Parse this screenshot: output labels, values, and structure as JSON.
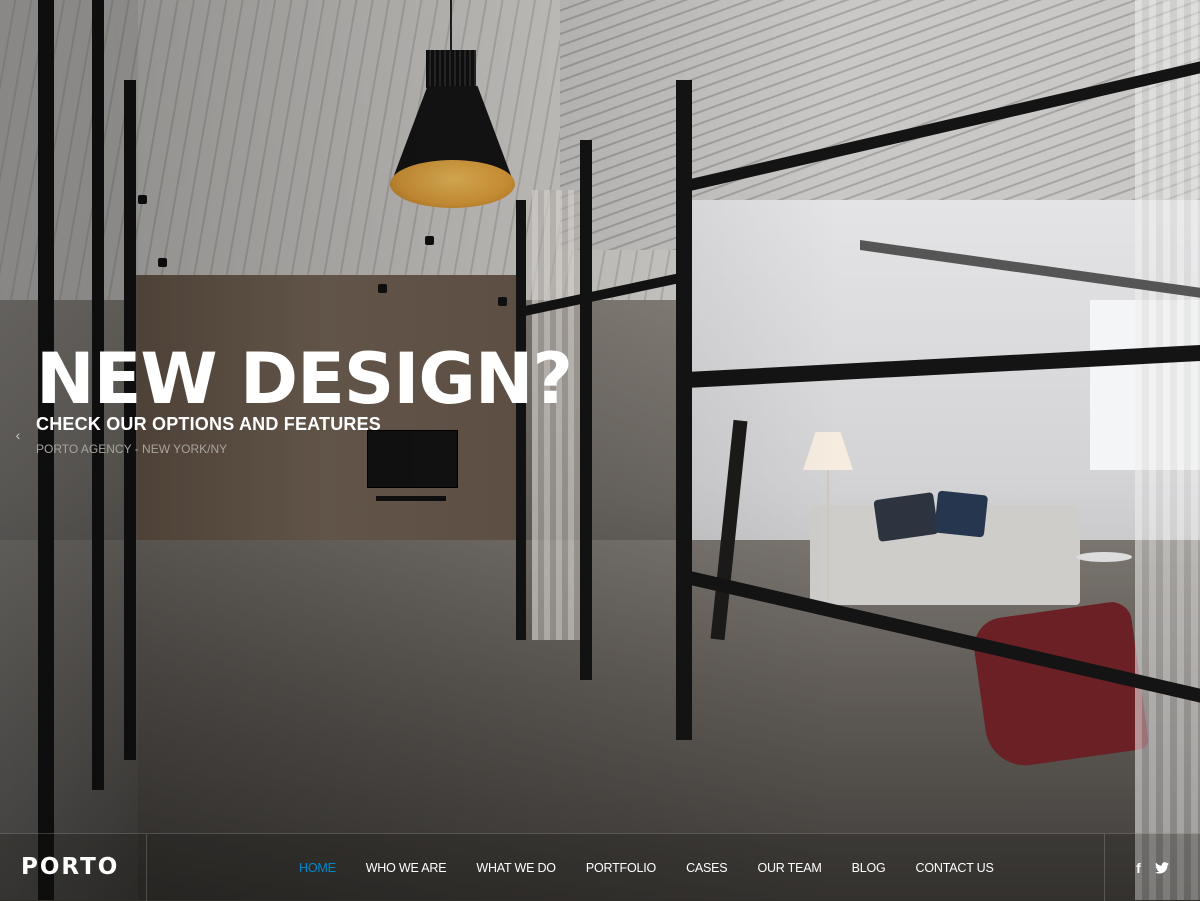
{
  "hero": {
    "title": "NEW DESIGN?",
    "subtitle": "CHECK OUR OPTIONS AND FEATURES",
    "caption": "PORTO AGENCY - NEW YORK/NY",
    "prev_arrow": "‹"
  },
  "nav": {
    "logo": "PORTO",
    "items": [
      {
        "label": "HOME",
        "active": true
      },
      {
        "label": "WHO WE ARE"
      },
      {
        "label": "WHAT WE DO"
      },
      {
        "label": "PORTFOLIO"
      },
      {
        "label": "CASES"
      },
      {
        "label": "OUR TEAM"
      },
      {
        "label": "BLOG"
      },
      {
        "label": "CONTACT US"
      }
    ],
    "social": [
      {
        "icon": "facebook-icon",
        "glyph": "f"
      },
      {
        "icon": "twitter-icon"
      }
    ]
  },
  "colors": {
    "accent": "#0088cc",
    "text": "#ffffff"
  }
}
